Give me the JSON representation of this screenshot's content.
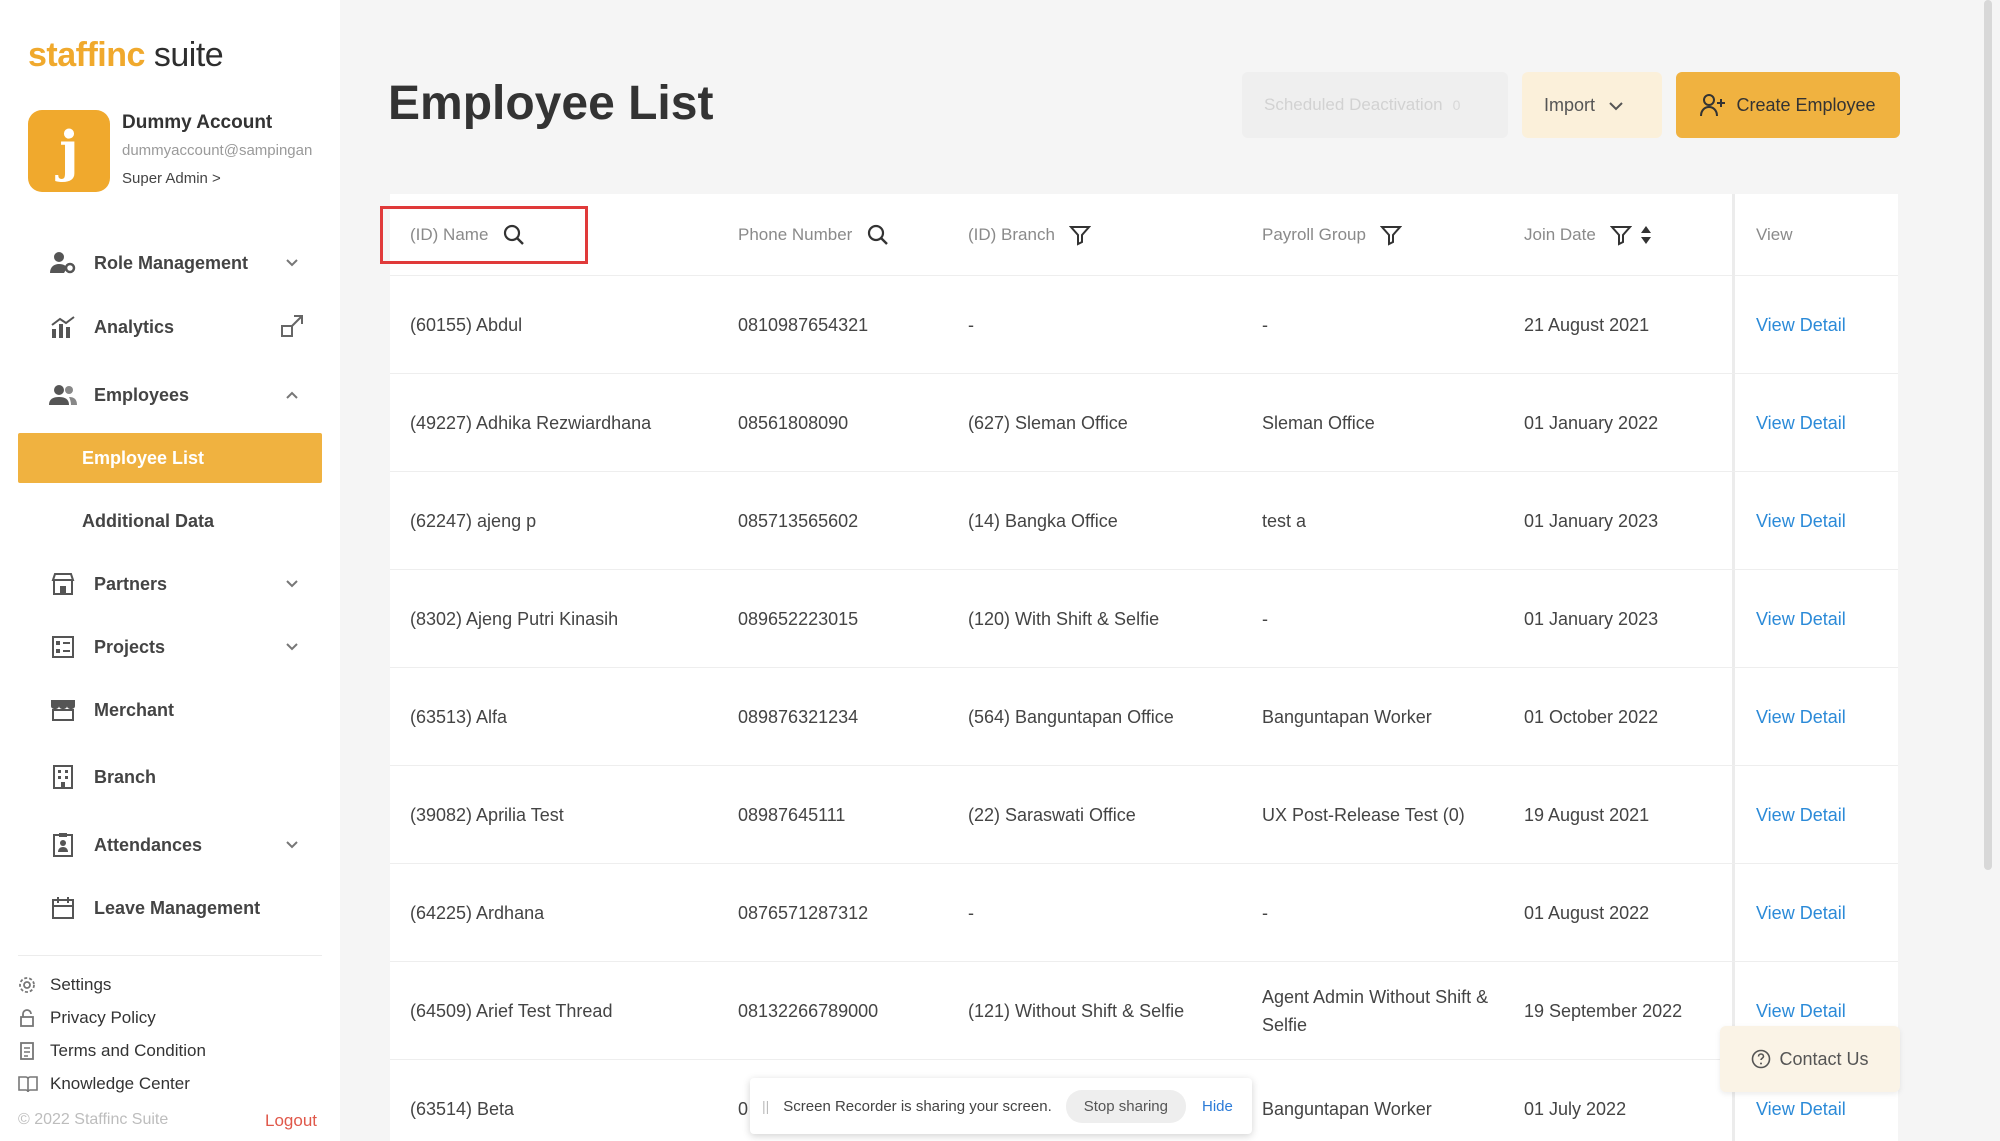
{
  "app": {
    "logo_brand": "staffinc",
    "logo_suffix": "suite"
  },
  "account": {
    "avatar_letter": "j",
    "name": "Dummy Account",
    "email": "dummyaccount@sampingan",
    "role": "Super Admin >"
  },
  "sidebar": {
    "role_management": "Role Management",
    "analytics": "Analytics",
    "employees": "Employees",
    "employee_list": "Employee List",
    "additional_data": "Additional Data",
    "partners": "Partners",
    "projects": "Projects",
    "merchant": "Merchant",
    "branch": "Branch",
    "attendances": "Attendances",
    "leave_management": "Leave Management"
  },
  "footer": {
    "settings": "Settings",
    "privacy_policy": "Privacy Policy",
    "terms": "Terms and Condition",
    "knowledge_center": "Knowledge Center",
    "copyright": "© 2022 Staffinc Suite",
    "logout": "Logout"
  },
  "header": {
    "title": "Employee List",
    "scheduled_deactivation": "Scheduled Deactivation",
    "scheduled_count": "0",
    "import": "Import",
    "create_employee": "Create Employee"
  },
  "table": {
    "columns": {
      "name": "(ID) Name",
      "phone": "Phone Number",
      "branch": "(ID) Branch",
      "payroll": "Payroll Group",
      "join_date": "Join Date",
      "view": "View"
    },
    "rows": [
      {
        "name": "(60155) Abdul",
        "phone": "0810987654321",
        "branch": "-",
        "payroll": "-",
        "join": "21 August 2021",
        "view": "View Detail"
      },
      {
        "name": "(49227) Adhika Rezwiardhana",
        "phone": "08561808090",
        "branch": "(627) Sleman Office",
        "payroll": "Sleman Office",
        "join": "01 January 2022",
        "view": "View Detail"
      },
      {
        "name": "(62247) ajeng p",
        "phone": "085713565602",
        "branch": "(14) Bangka Office",
        "payroll": "test a",
        "join": "01 January 2023",
        "view": "View Detail"
      },
      {
        "name": "(8302) Ajeng Putri Kinasih",
        "phone": "089652223015",
        "branch": "(120) With Shift & Selfie",
        "payroll": "-",
        "join": "01 January 2023",
        "view": "View Detail"
      },
      {
        "name": "(63513) Alfa",
        "phone": "089876321234",
        "branch": "(564) Banguntapan Office",
        "payroll": "Banguntapan Worker",
        "join": "01 October 2022",
        "view": "View Detail"
      },
      {
        "name": "(39082) Aprilia Test",
        "phone": "08987645111",
        "branch": "(22) Saraswati Office",
        "payroll": "UX Post-Release Test (0)",
        "join": "19 August 2021",
        "view": "View Detail"
      },
      {
        "name": "(64225) Ardhana",
        "phone": "0876571287312",
        "branch": "-",
        "payroll": "-",
        "join": "01 August 2022",
        "view": "View Detail"
      },
      {
        "name": "(64509) Arief Test Thread",
        "phone": "08132266789000",
        "branch": "(121) Without Shift & Selfie",
        "payroll": "Agent Admin Without Shift & Selfie",
        "join": "19 September 2022",
        "view": "View Detail"
      },
      {
        "name": "(63514) Beta",
        "phone": "0",
        "branch": "",
        "payroll": "Banguntapan Worker",
        "join": "01 July 2022",
        "view": "View Detail"
      }
    ]
  },
  "contact": {
    "label": "Contact Us"
  },
  "recorder": {
    "message": "Screen Recorder is sharing your screen.",
    "stop": "Stop sharing",
    "hide": "Hide"
  },
  "colors": {
    "accent": "#f0b240",
    "link": "#2b8ad8",
    "logout": "#e0584a",
    "highlight": "#e03a3a"
  }
}
